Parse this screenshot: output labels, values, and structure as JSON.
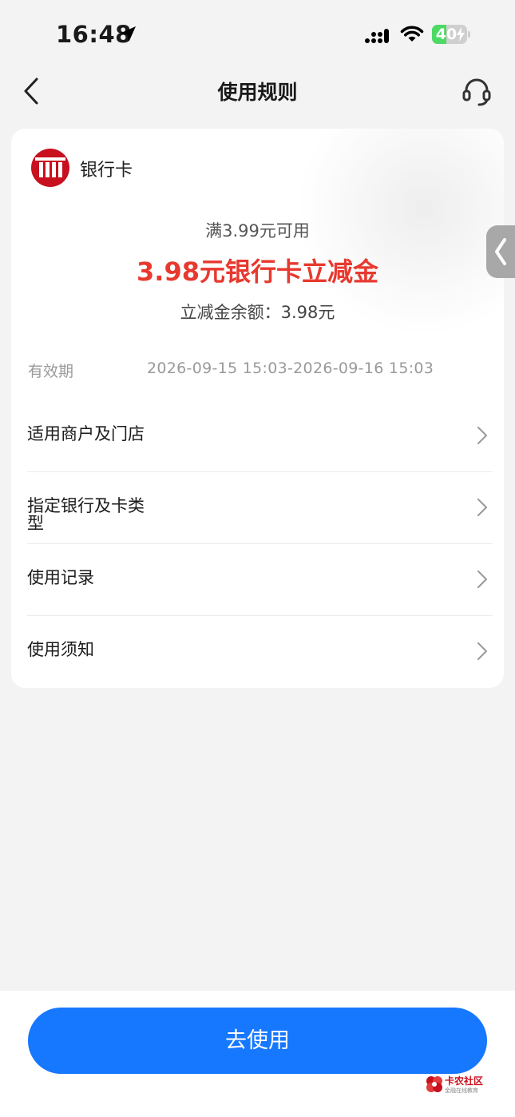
{
  "status_bar": {
    "time": "16:48",
    "battery_level": "40",
    "battery_fraction": 0.4,
    "icons": [
      "location-arrow-icon",
      "cellular-signal-icon",
      "wifi-icon",
      "battery-charging-icon"
    ]
  },
  "nav": {
    "title": "使用规则",
    "back_icon": "chevron-left-icon",
    "service_icon": "headset-icon"
  },
  "coupon": {
    "bank_label": "银行卡",
    "bank_logo_icon": "bank-logo-icon",
    "threshold": "满3.99元可用",
    "title": "3.98元银行卡立减金",
    "balance": "立减金余额：3.98元",
    "validity_label": "有效期",
    "validity_value": "2026-09-15 15:03-2026-09-16 15:03"
  },
  "menu": [
    {
      "label": "适用商户及门店"
    },
    {
      "label": "指定银行及卡类\n型"
    },
    {
      "label": "使用记录"
    },
    {
      "label": "使用须知"
    }
  ],
  "side_tab_icon": "chevron-left-icon",
  "action": {
    "use_label": "去使用"
  },
  "watermark": {
    "title": "卡农社区",
    "subtitle": "金融在线教育"
  },
  "colors": {
    "accent": "#1677ff",
    "highlight_red": "#e8392f",
    "battery_green": "#4cd964",
    "bank_logo_red": "#c8101e"
  }
}
